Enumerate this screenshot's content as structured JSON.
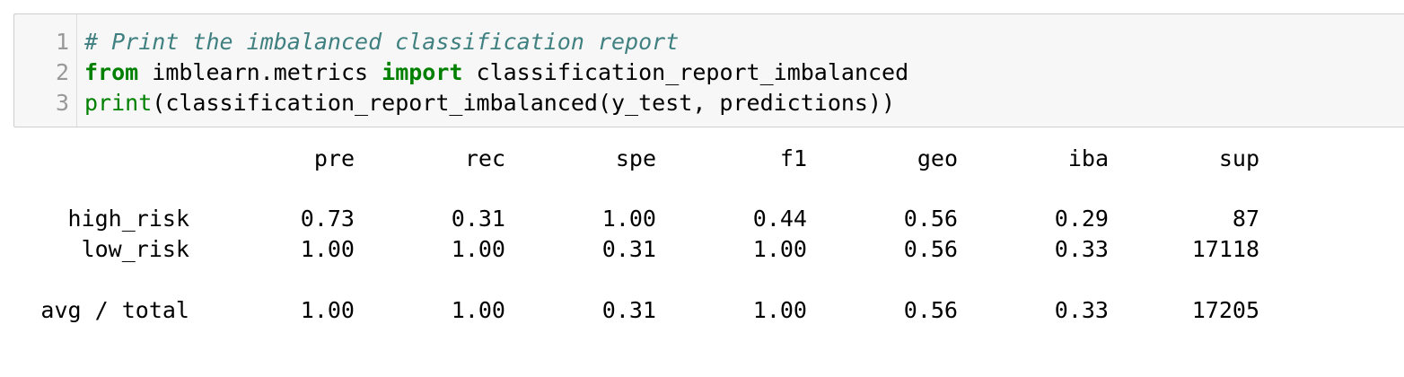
{
  "code_cell": {
    "line_numbers": [
      "1",
      "2",
      "3"
    ],
    "lines": [
      {
        "comment": "# Print the imbalanced classification report"
      },
      {
        "kw_from": "from",
        "module": " imblearn.metrics ",
        "kw_import": "import",
        "name": " classification_report_imbalanced"
      },
      {
        "builtin_print": "print",
        "args": "(classification_report_imbalanced(y_test, predictions))"
      }
    ]
  },
  "report": {
    "headers": [
      "pre",
      "rec",
      "spe",
      "f1",
      "geo",
      "iba",
      "sup"
    ],
    "rows": [
      {
        "label": "high_risk",
        "values": [
          "0.73",
          "0.31",
          "1.00",
          "0.44",
          "0.56",
          "0.29",
          "87"
        ]
      },
      {
        "label": "low_risk",
        "values": [
          "1.00",
          "1.00",
          "0.31",
          "1.00",
          "0.56",
          "0.33",
          "17118"
        ]
      },
      {
        "label": "avg / total",
        "values": [
          "1.00",
          "1.00",
          "0.31",
          "1.00",
          "0.56",
          "0.33",
          "17205"
        ]
      }
    ]
  },
  "colors": {
    "comment": "#408080",
    "keyword": "#008000",
    "cell_background": "#f7f7f7",
    "line_number": "#999999"
  }
}
